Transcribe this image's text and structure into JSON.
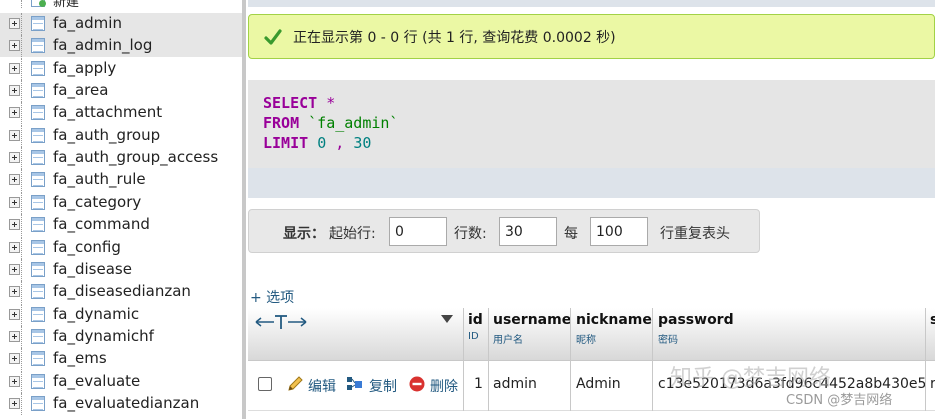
{
  "nav": {
    "new_label": "新建",
    "items": [
      "fa_admin",
      "fa_admin_log",
      "fa_apply",
      "fa_area",
      "fa_attachment",
      "fa_auth_group",
      "fa_auth_group_access",
      "fa_auth_rule",
      "fa_category",
      "fa_command",
      "fa_config",
      "fa_disease",
      "fa_diseasedianzan",
      "fa_dynamic",
      "fa_dynamichf",
      "fa_ems",
      "fa_evaluate",
      "fa_evaluatedianzan"
    ]
  },
  "message": {
    "text": "正在显示第 0 - 0 行 (共 1 行, 查询花费 0.0002 秒)",
    "icon": "check-icon",
    "color": "#ebf8a4"
  },
  "sql": {
    "select_kw": "SELECT",
    "star": "*",
    "from_kw": "FROM",
    "table": "`fa_admin`",
    "limit_kw": "LIMIT",
    "offset": "0",
    "comma": ",",
    "count": "30"
  },
  "navbar": {
    "display_label": "显示：",
    "start_label": "起始行:",
    "start_value": "0",
    "rows_label": "行数:",
    "rows_value": "30",
    "every_label": "每",
    "every_value": "100",
    "repeat_label": "行重复表头"
  },
  "options_link": "+ 选项",
  "grid": {
    "sort_icon": "sort-triangle-icon",
    "resize_icon": "column-resize-icon",
    "columns": [
      {
        "name": "id",
        "comment": "ID"
      },
      {
        "name": "username",
        "comment": "用户名"
      },
      {
        "name": "nickname",
        "comment": "昵称"
      },
      {
        "name": "password",
        "comment": "密码"
      },
      {
        "name": "s",
        "comment": ""
      }
    ],
    "actions": {
      "edit": "编辑",
      "copy": "复制",
      "delete": "删除"
    },
    "row": {
      "id": "1",
      "username": "admin",
      "nickname": "Admin",
      "password": "c13e520173d6a3fd96c4452a8b430e5",
      "extra": "r"
    }
  },
  "watermark": {
    "main": "知乎 @梦吉网络",
    "sub": "CSDN @梦吉网络"
  }
}
